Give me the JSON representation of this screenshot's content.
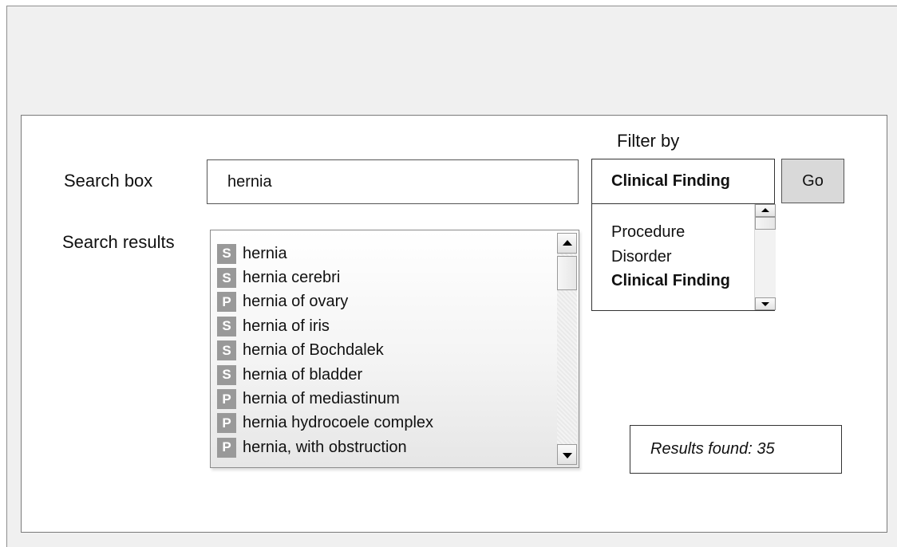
{
  "search": {
    "label": "Search box",
    "value": "hernia"
  },
  "results": {
    "label": "Search results",
    "items": [
      {
        "badge": "S",
        "text": "hernia"
      },
      {
        "badge": "S",
        "text": "hernia cerebri"
      },
      {
        "badge": "P",
        "text": "hernia of ovary"
      },
      {
        "badge": "S",
        "text": "hernia of iris"
      },
      {
        "badge": "S",
        "text": "hernia of Bochdalek"
      },
      {
        "badge": "S",
        "text": "hernia of bladder"
      },
      {
        "badge": "P",
        "text": "hernia of mediastinum"
      },
      {
        "badge": "P",
        "text": "hernia hydrocoele complex"
      },
      {
        "badge": "P",
        "text": "hernia, with obstruction"
      }
    ],
    "count_text": "Results found: 35"
  },
  "filter": {
    "label": "Filter by",
    "selected": "Clinical Finding",
    "options": [
      "Procedure",
      "Disorder",
      "Clinical Finding"
    ]
  },
  "go_button": "Go",
  "colors": {
    "background": "#f0f0f0",
    "panel": "#ffffff",
    "badge": "#999999",
    "go_button": "#d9d9d9"
  }
}
